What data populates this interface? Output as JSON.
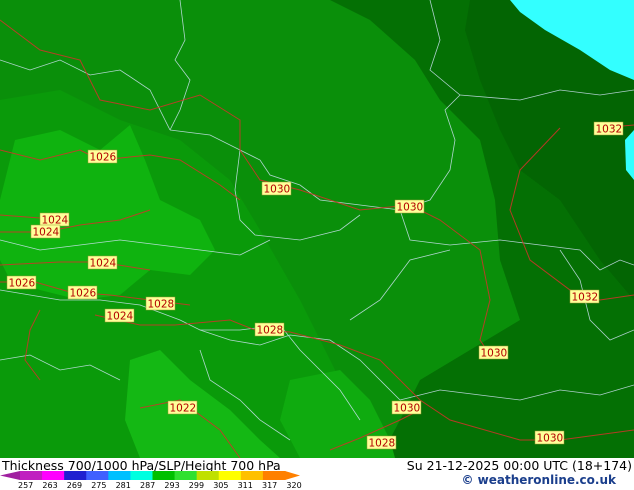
{
  "footer": {
    "title_left": "Thickness 700/1000 hPa/SLP/Height 700 hPa",
    "title_right": "Su 21-12-2025 00:00 UTC (18+174)",
    "credit": "© weatheronline.co.uk"
  },
  "legend": {
    "ticks": [
      "257",
      "263",
      "269",
      "275",
      "281",
      "287",
      "293",
      "299",
      "305",
      "311",
      "317",
      "320"
    ],
    "colors": [
      "#c020c0",
      "#ff00ff",
      "#2020d0",
      "#4060ff",
      "#00c0ff",
      "#00ffe0",
      "#00c000",
      "#30e030",
      "#c0e000",
      "#ffff00",
      "#ffc000",
      "#ff8000"
    ]
  },
  "map": {
    "isobar_labels": [
      {
        "id": "l1",
        "text": "1026"
      },
      {
        "id": "l2",
        "text": "1030"
      },
      {
        "id": "l3",
        "text": "1030"
      },
      {
        "id": "l4",
        "text": "1032"
      },
      {
        "id": "l5",
        "text": "1024"
      },
      {
        "id": "l6",
        "text": "1024"
      },
      {
        "id": "l7",
        "text": "1024"
      },
      {
        "id": "l8",
        "text": "1026"
      },
      {
        "id": "l9",
        "text": "1026"
      },
      {
        "id": "l10",
        "text": "1028"
      },
      {
        "id": "l11",
        "text": "1024"
      },
      {
        "id": "l12",
        "text": "1028"
      },
      {
        "id": "l13",
        "text": "1032"
      },
      {
        "id": "l14",
        "text": "1030"
      },
      {
        "id": "l15",
        "text": "1022"
      },
      {
        "id": "l16",
        "text": "1030"
      },
      {
        "id": "l17",
        "text": "1028"
      },
      {
        "id": "l18",
        "text": "1030"
      }
    ]
  }
}
